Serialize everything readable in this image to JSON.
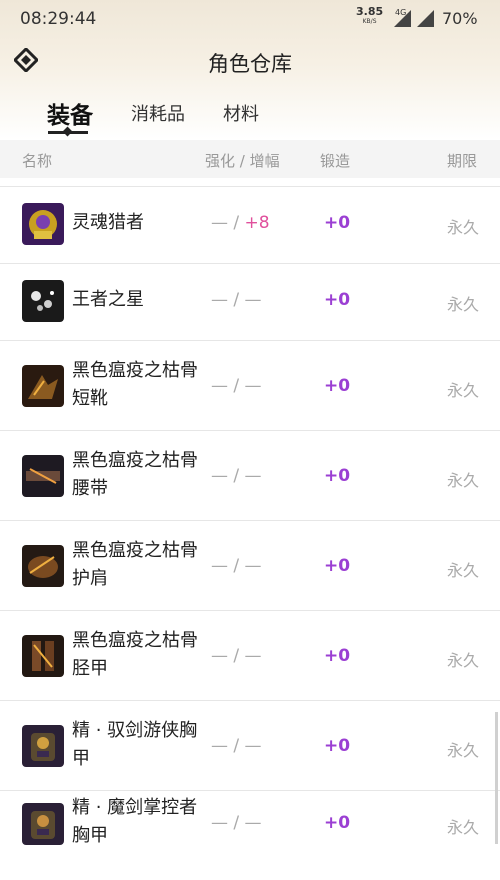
{
  "status": {
    "time": "08:29:44",
    "speed": "3.85",
    "speed_unit": "KB/S",
    "network": "4G",
    "battery": "70%"
  },
  "titlebar": {
    "title": "角色仓库"
  },
  "tabs": [
    {
      "label": "装备",
      "active": true
    },
    {
      "label": "消耗品",
      "active": false
    },
    {
      "label": "材料",
      "active": false
    }
  ],
  "columns": {
    "name": "名称",
    "enhance": "强化 / 增幅",
    "forge": "锻造",
    "period": "期限"
  },
  "items": [
    {
      "name": "灵魂猎者",
      "enhance": "— /",
      "amp": "+8",
      "forge": "+0",
      "period": "永久",
      "icon": "soul-hunter-icon"
    },
    {
      "name": "王者之星",
      "enhance": "— / —",
      "amp": "",
      "forge": "+0",
      "period": "永久",
      "icon": "king-star-icon"
    },
    {
      "name": "黑色瘟疫之枯骨短靴",
      "enhance": "— / —",
      "amp": "",
      "forge": "+0",
      "period": "永久",
      "icon": "plague-boots-icon"
    },
    {
      "name": "黑色瘟疫之枯骨腰带",
      "enhance": "— / —",
      "amp": "",
      "forge": "+0",
      "period": "永久",
      "icon": "plague-belt-icon"
    },
    {
      "name": "黑色瘟疫之枯骨护肩",
      "enhance": "— / —",
      "amp": "",
      "forge": "+0",
      "period": "永久",
      "icon": "plague-shoulder-icon"
    },
    {
      "name": "黑色瘟疫之枯骨胫甲",
      "enhance": "— / —",
      "amp": "",
      "forge": "+0",
      "period": "永久",
      "icon": "plague-legs-icon"
    },
    {
      "name": "精 · 驭剑游侠胸甲",
      "enhance": "— / —",
      "amp": "",
      "forge": "+0",
      "period": "永久",
      "icon": "ranger-chest-icon"
    },
    {
      "name": "精 · 魔剑掌控者胸甲",
      "enhance": "— / —",
      "amp": "",
      "forge": "+0",
      "period": "永久",
      "icon": "magic-sword-chest-icon"
    }
  ],
  "colors": {
    "forge": "#9b3fd3",
    "amp": "#e0509c",
    "muted": "#aaaaaa"
  }
}
